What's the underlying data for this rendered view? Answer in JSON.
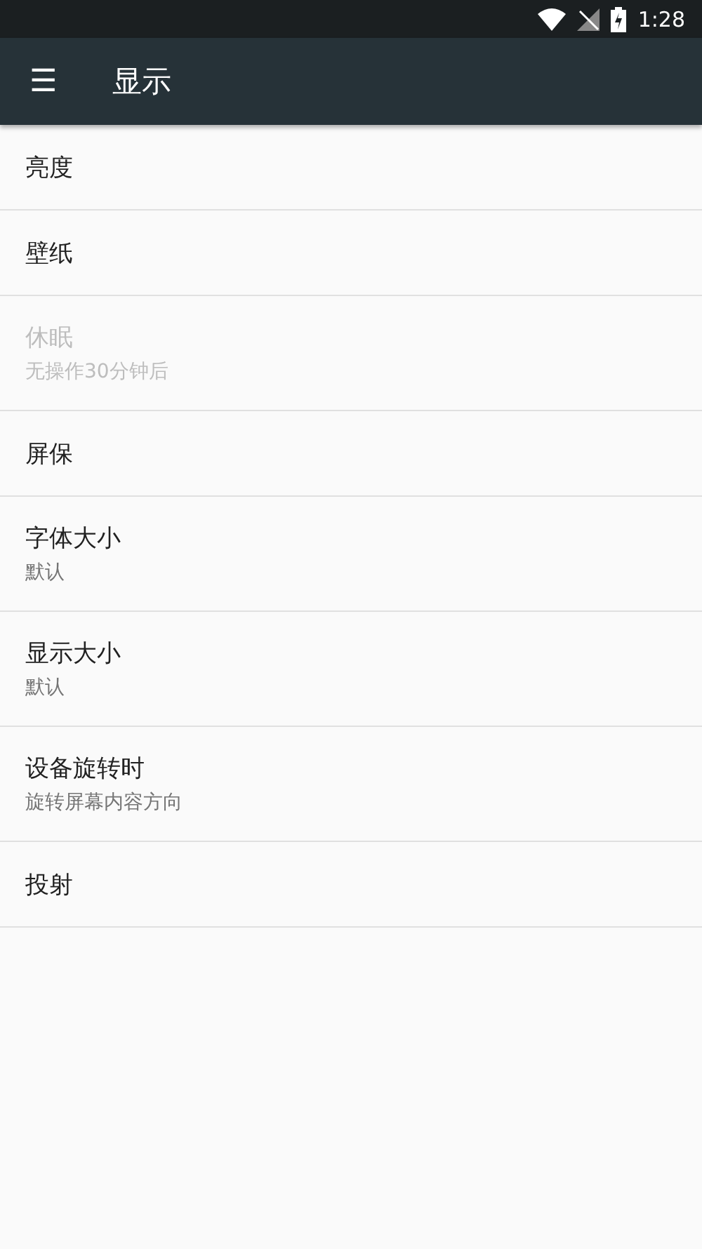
{
  "status_bar": {
    "time": "1:28"
  },
  "app_bar": {
    "menu": "☰",
    "title": "显示"
  },
  "settings": [
    {
      "title": "亮度",
      "disabled": false
    },
    {
      "title": "壁纸",
      "disabled": false
    },
    {
      "title": "休眠",
      "summary": "无操作30分钟后",
      "disabled": true
    },
    {
      "title": "屏保",
      "disabled": false
    },
    {
      "title": "字体大小",
      "summary": "默认",
      "disabled": false
    },
    {
      "title": "显示大小",
      "summary": "默认",
      "disabled": false
    },
    {
      "title": "设备旋转时",
      "summary": "旋转屏幕内容方向",
      "disabled": false
    },
    {
      "title": "投射",
      "disabled": false
    }
  ]
}
